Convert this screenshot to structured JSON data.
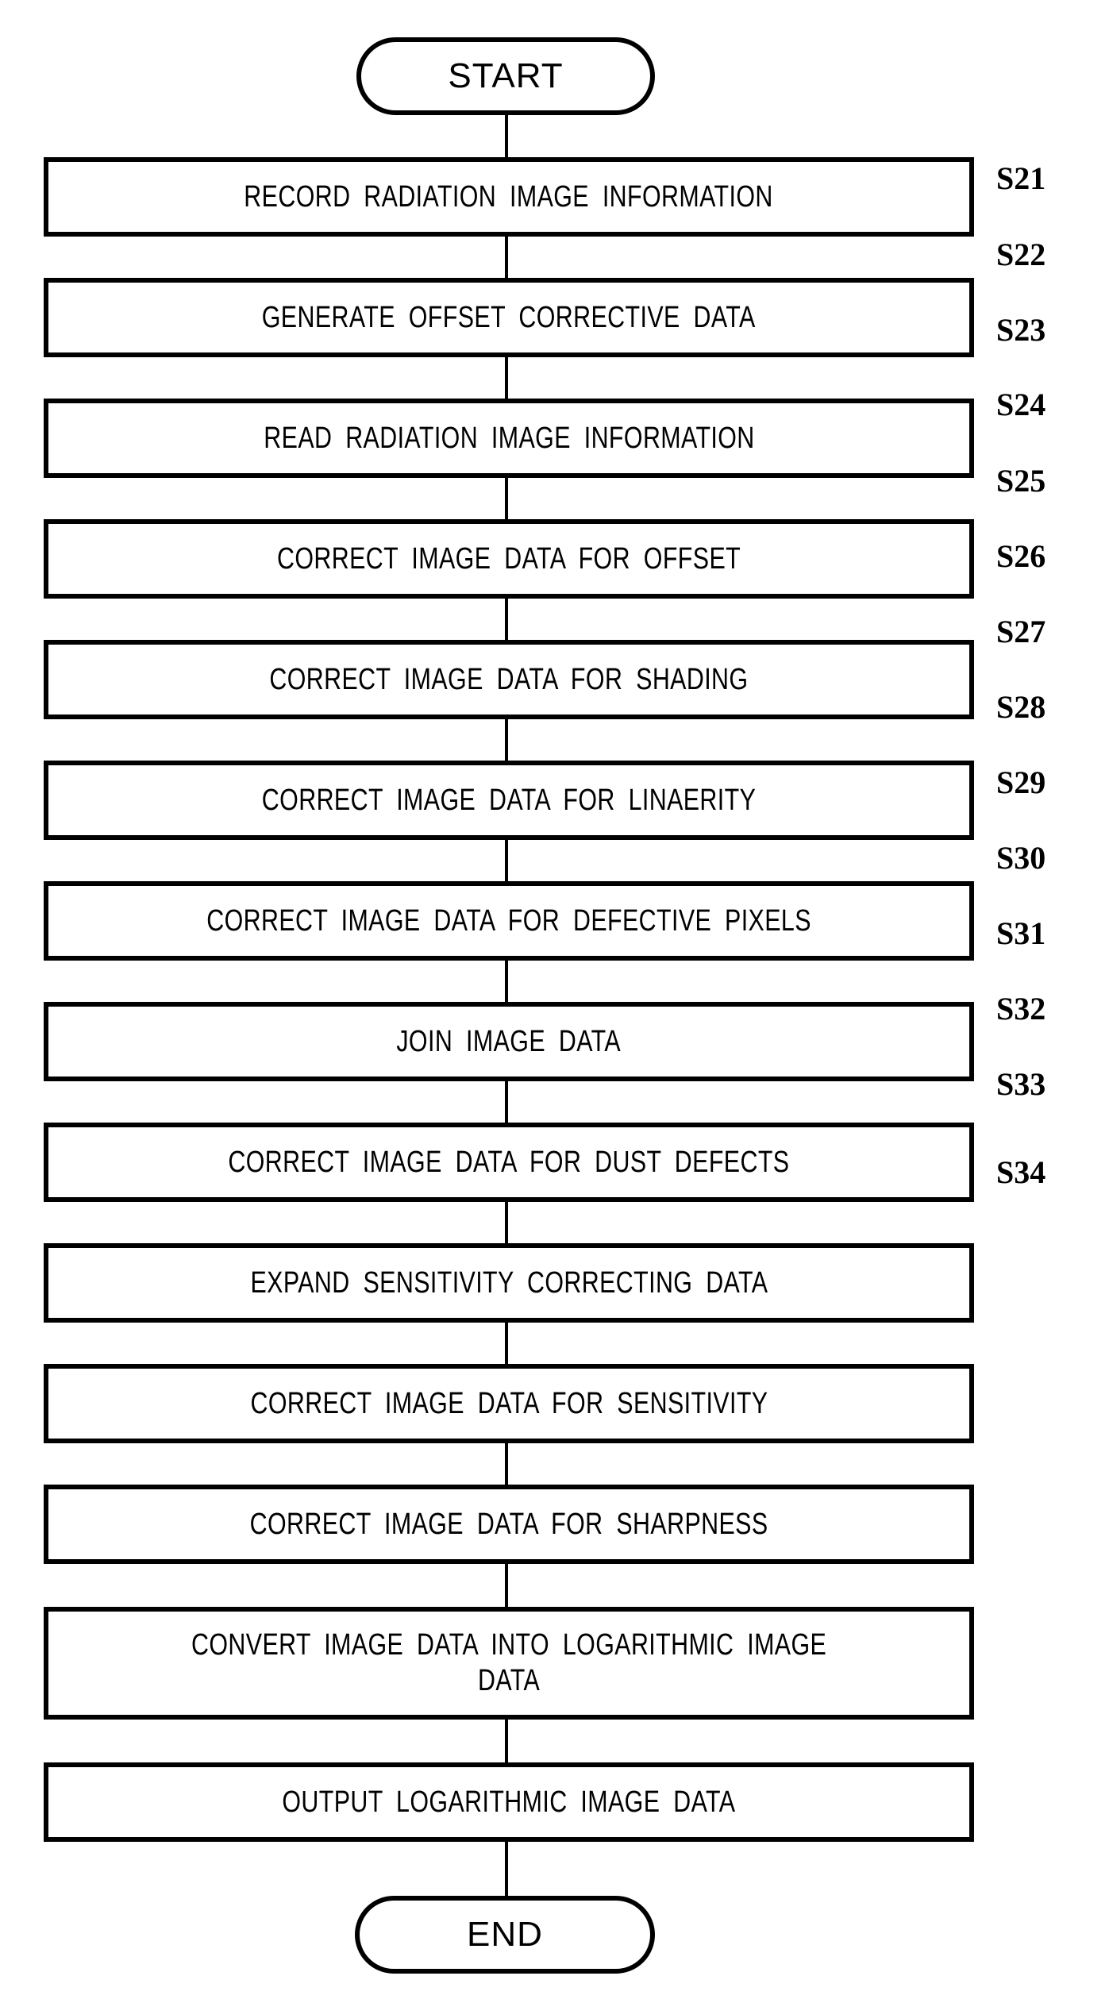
{
  "figure": {
    "type": "flowchart",
    "orientation": "vertical",
    "title": "Radiation image information processing flowchart",
    "line_color": "#000000",
    "background_color": "#ffffff"
  },
  "start_node": {
    "shape": "terminator",
    "label": "START"
  },
  "end_node": {
    "shape": "terminator",
    "label": "END"
  },
  "steps": [
    {
      "ref": "S21",
      "label": "RECORD RADIATION IMAGE INFORMATION"
    },
    {
      "ref": "S22",
      "label": "GENERATE OFFSET CORRECTIVE DATA"
    },
    {
      "ref": "S23",
      "label": "READ RADIATION IMAGE INFORMATION"
    },
    {
      "ref": "S24",
      "label": "CORRECT IMAGE DATA FOR OFFSET"
    },
    {
      "ref": "S25",
      "label": "CORRECT IMAGE DATA FOR SHADING"
    },
    {
      "ref": "S26",
      "label": "CORRECT IMAGE DATA FOR LINAERITY"
    },
    {
      "ref": "S27",
      "label": "CORRECT IMAGE DATA FOR DEFECTIVE PIXELS"
    },
    {
      "ref": "S28",
      "label": "JOIN IMAGE DATA"
    },
    {
      "ref": "S29",
      "label": "CORRECT IMAGE DATA FOR DUST DEFECTS"
    },
    {
      "ref": "S30",
      "label": "EXPAND SENSITIVITY CORRECTING DATA"
    },
    {
      "ref": "S31",
      "label": "CORRECT IMAGE DATA FOR SENSITIVITY"
    },
    {
      "ref": "S32",
      "label": "CORRECT IMAGE DATA FOR SHARPNESS"
    },
    {
      "ref": "S33",
      "label": "CONVERT IMAGE DATA INTO LOGARITHMIC IMAGE\nDATA"
    },
    {
      "ref": "S34",
      "label": "OUTPUT LOGARITHMIC IMAGE DATA"
    }
  ]
}
